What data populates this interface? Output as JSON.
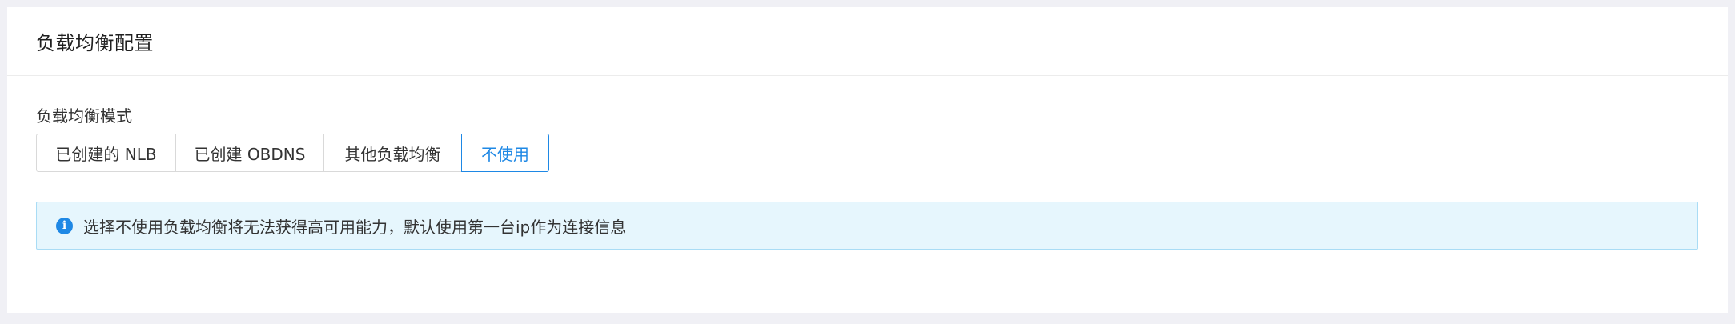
{
  "card": {
    "title": "负载均衡配置"
  },
  "form": {
    "mode_label": "负载均衡模式",
    "options": [
      {
        "label": "已创建的 NLB",
        "selected": false
      },
      {
        "label": "已创建 OBDNS",
        "selected": false
      },
      {
        "label": "其他负载均衡",
        "selected": false
      },
      {
        "label": "不使用",
        "selected": true
      }
    ]
  },
  "alert": {
    "icon": "info-icon",
    "icon_glyph": "i",
    "text": "选择不使用负载均衡将无法获得高可用能力，默认使用第一台ip作为连接信息"
  },
  "colors": {
    "accent": "#1e88e5",
    "alert_bg": "#e6f6fd",
    "alert_border": "#a9dcf5",
    "page_bg": "#f0f0f5"
  }
}
